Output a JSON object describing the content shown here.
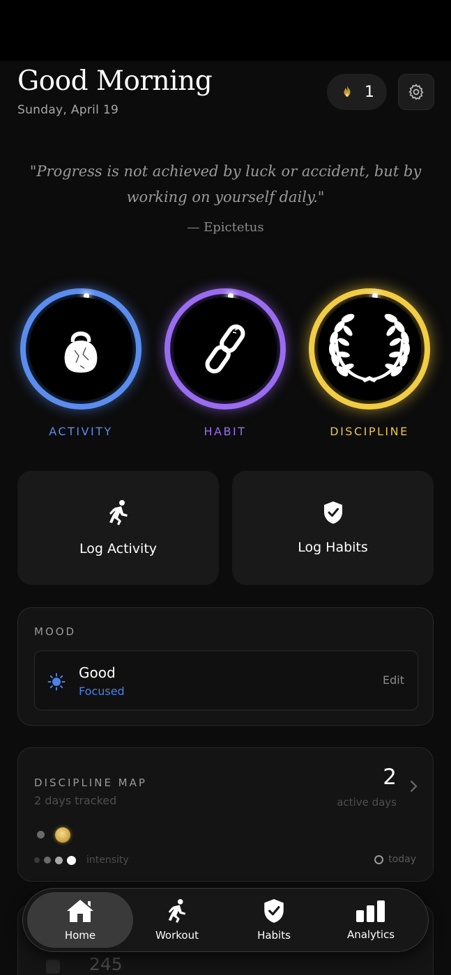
{
  "header": {
    "greeting": "Good Morning",
    "date": "Sunday, April 19",
    "streak_count": "1",
    "icons": {
      "streak": "flame-icon",
      "settings": "gear-icon"
    }
  },
  "quote": {
    "text": "\"Progress is not achieved by luck or accident, but by working on yourself daily.\"",
    "author": "— Epictetus"
  },
  "rings": [
    {
      "label": "ACTIVITY",
      "icon": "kettlebell-icon",
      "color": "#5b8def"
    },
    {
      "label": "HABIT",
      "icon": "chain-link-icon",
      "color": "#9a6cf0"
    },
    {
      "label": "DISCIPLINE",
      "icon": "laurel-wreath-icon",
      "color": "#f2cd44"
    }
  ],
  "actions": {
    "log_activity": "Log Activity",
    "log_habits": "Log Habits",
    "icons": {
      "log_activity": "running-person-icon",
      "log_habits": "shield-check-icon"
    }
  },
  "mood": {
    "title": "MOOD",
    "state": "Good",
    "detail": "Focused",
    "edit": "Edit",
    "icon": "sun-icon",
    "accent": "#4a82e8"
  },
  "discipline_map": {
    "title": "DISCIPLINE MAP",
    "subtitle": "2 days tracked",
    "count": "2",
    "count_label": "active days",
    "legend_label": "intensity",
    "today_label": "today",
    "icons": {
      "chevron": "chevron-right-icon"
    }
  },
  "partial_card": {
    "value": "245"
  },
  "tabs": [
    {
      "label": "Home",
      "icon": "home-icon",
      "active": true
    },
    {
      "label": "Workout",
      "icon": "running-person-icon",
      "active": false
    },
    {
      "label": "Habits",
      "icon": "shield-check-icon",
      "active": false
    },
    {
      "label": "Analytics",
      "icon": "bar-chart-icon",
      "active": false
    }
  ]
}
